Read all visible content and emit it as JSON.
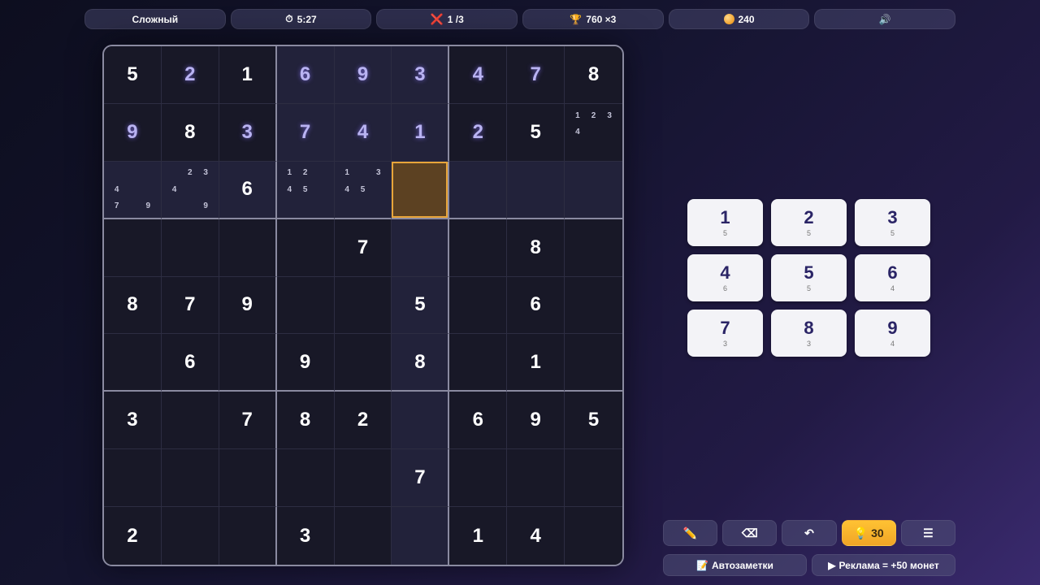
{
  "topbar": {
    "difficulty": "Сложный",
    "timer_icon": "⏱",
    "timer": "5:27",
    "mistakes_icon": "❌",
    "mistakes": "1 /3",
    "score_icon": "🏆",
    "score": "760 ×3",
    "coins": "240",
    "sound_icon": "🔊"
  },
  "board": {
    "selected": [
      2,
      5
    ],
    "cells": [
      [
        {
          "v": "5",
          "t": "given"
        },
        {
          "v": "2",
          "t": "user"
        },
        {
          "v": "1",
          "t": "given"
        },
        {
          "v": "6",
          "t": "user"
        },
        {
          "v": "9",
          "t": "user"
        },
        {
          "v": "3",
          "t": "user"
        },
        {
          "v": "4",
          "t": "user"
        },
        {
          "v": "7",
          "t": "user"
        },
        {
          "v": "8",
          "t": "given"
        }
      ],
      [
        {
          "v": "9",
          "t": "user"
        },
        {
          "v": "8",
          "t": "given"
        },
        {
          "v": "3",
          "t": "user"
        },
        {
          "v": "7",
          "t": "user"
        },
        {
          "v": "4",
          "t": "user"
        },
        {
          "v": "1",
          "t": "user"
        },
        {
          "v": "2",
          "t": "user"
        },
        {
          "v": "5",
          "t": "given"
        },
        {
          "notes": [
            "1",
            "2",
            "3",
            "4",
            "",
            "",
            "",
            "",
            ""
          ]
        }
      ],
      [
        {
          "notes": [
            "",
            "",
            "",
            "4",
            "",
            "",
            "7",
            "",
            "9"
          ]
        },
        {
          "notes": [
            "",
            "2",
            "3",
            "4",
            "",
            "",
            "",
            "",
            "9"
          ]
        },
        {
          "v": "6",
          "t": "given"
        },
        {
          "notes": [
            "1",
            "2",
            "",
            "4",
            "5",
            "",
            "",
            "",
            ""
          ]
        },
        {
          "notes": [
            "1",
            "",
            "3",
            "4",
            "5",
            "",
            "",
            "",
            ""
          ]
        },
        {},
        {},
        {},
        {}
      ],
      [
        {},
        {},
        {},
        {},
        {
          "v": "7",
          "t": "given"
        },
        {},
        {},
        {
          "v": "8",
          "t": "given"
        },
        {}
      ],
      [
        {
          "v": "8",
          "t": "given"
        },
        {
          "v": "7",
          "t": "given"
        },
        {
          "v": "9",
          "t": "given"
        },
        {},
        {},
        {
          "v": "5",
          "t": "given"
        },
        {},
        {
          "v": "6",
          "t": "given"
        },
        {}
      ],
      [
        {},
        {
          "v": "6",
          "t": "given"
        },
        {},
        {
          "v": "9",
          "t": "given"
        },
        {},
        {
          "v": "8",
          "t": "given"
        },
        {},
        {
          "v": "1",
          "t": "given"
        },
        {}
      ],
      [
        {
          "v": "3",
          "t": "given"
        },
        {},
        {
          "v": "7",
          "t": "given"
        },
        {
          "v": "8",
          "t": "given"
        },
        {
          "v": "2",
          "t": "given"
        },
        {},
        {
          "v": "6",
          "t": "given"
        },
        {
          "v": "9",
          "t": "given"
        },
        {
          "v": "5",
          "t": "given"
        }
      ],
      [
        {},
        {},
        {},
        {},
        {},
        {
          "v": "7",
          "t": "given"
        },
        {},
        {},
        {}
      ],
      [
        {
          "v": "2",
          "t": "given"
        },
        {},
        {},
        {
          "v": "3",
          "t": "given"
        },
        {},
        {},
        {
          "v": "1",
          "t": "given"
        },
        {
          "v": "4",
          "t": "given"
        },
        {}
      ]
    ]
  },
  "numpad": [
    {
      "n": "1",
      "c": "5"
    },
    {
      "n": "2",
      "c": "5"
    },
    {
      "n": "3",
      "c": "5"
    },
    {
      "n": "4",
      "c": "6"
    },
    {
      "n": "5",
      "c": "5"
    },
    {
      "n": "6",
      "c": "4"
    },
    {
      "n": "7",
      "c": "3"
    },
    {
      "n": "8",
      "c": "3"
    },
    {
      "n": "9",
      "c": "4"
    }
  ],
  "toolbar": {
    "pencil_icon": "✏️",
    "erase_icon": "⌫",
    "undo_icon": "↶",
    "hint_icon": "💡",
    "hint_count": "30",
    "menu_icon": "☰"
  },
  "bottom": {
    "autonotes_icon": "📝",
    "autonotes": "Автозаметки",
    "ad_icon": "▶",
    "ad": "Реклама = +50 монет"
  }
}
